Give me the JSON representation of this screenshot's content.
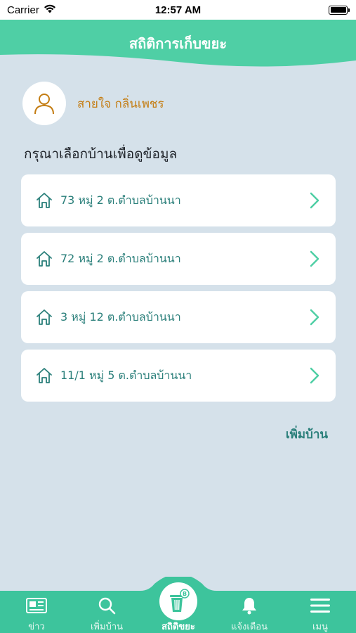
{
  "status_bar": {
    "carrier": "Carrier",
    "time": "12:57 AM"
  },
  "header": {
    "title": "สถิติการเก็บขยะ"
  },
  "profile": {
    "name": "สายใจ กลิ่นเพชร"
  },
  "prompt": "กรุณาเลือกบ้านเพื่อดูข้อมูล",
  "houses": [
    {
      "label": "73 หมู่ 2 ต.ตำบลบ้านนา"
    },
    {
      "label": "72 หมู่ 2 ต.ตำบลบ้านนา"
    },
    {
      "label": "3 หมู่ 12 ต.ตำบลบ้านนา"
    },
    {
      "label": "11/1 หมู่ 5 ต.ตำบลบ้านนา"
    }
  ],
  "add_house": "เพิ่มบ้าน",
  "tabs": [
    {
      "label": "ข่าว",
      "icon": "newspaper-icon"
    },
    {
      "label": "เพิ่มบ้าน",
      "icon": "search-icon"
    },
    {
      "label": "สถิติขยะ",
      "icon": "trash-bin-icon",
      "active": true
    },
    {
      "label": "แจ้งเตือน",
      "icon": "bell-icon"
    },
    {
      "label": "เมนู",
      "icon": "hamburger-menu-icon"
    }
  ],
  "colors": {
    "primary": "#4fcfa5",
    "background": "#d5e1ea",
    "accent_text": "#2a7f7a",
    "name_text": "#c47d13"
  }
}
